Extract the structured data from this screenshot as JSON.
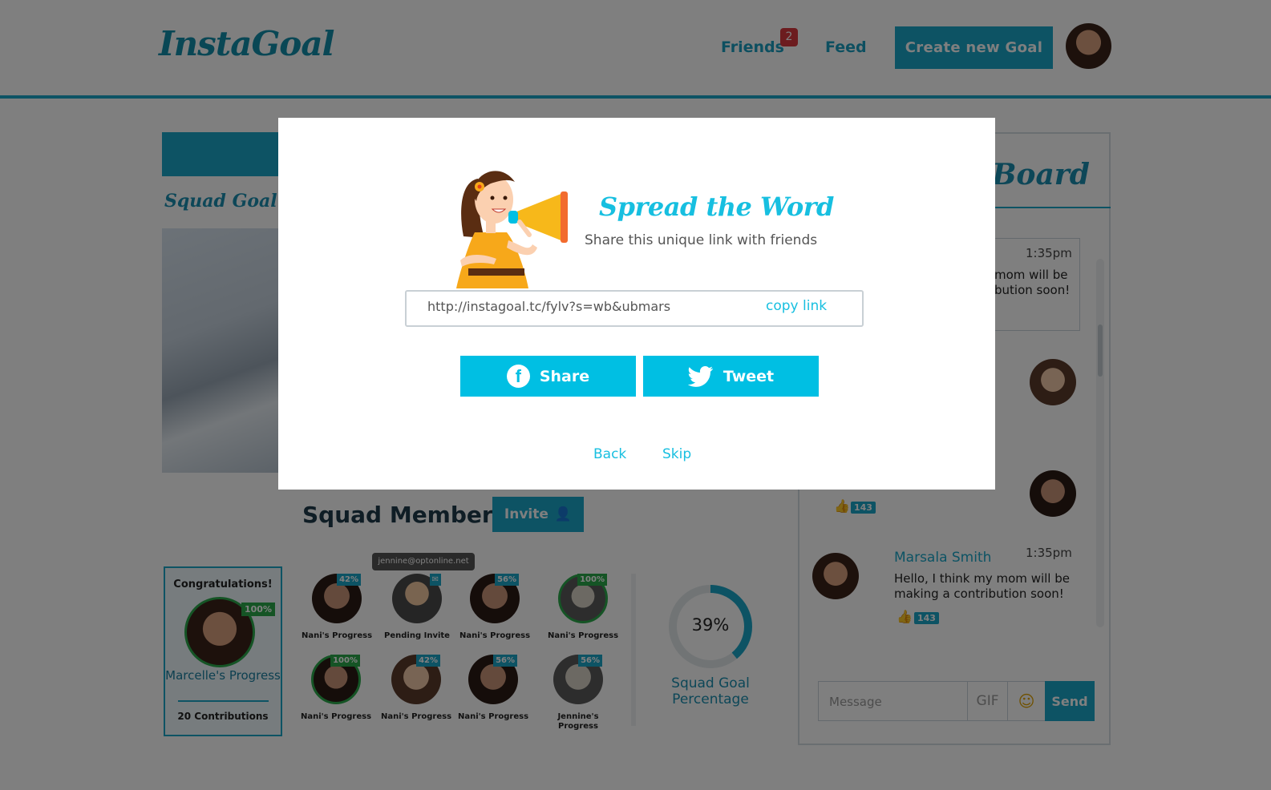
{
  "header": {
    "logo": "InstaGoal",
    "nav": {
      "friends": "Friends",
      "friends_badge": "2",
      "feed": "Feed"
    },
    "create_button": "Create new Goal"
  },
  "background": {
    "squad_goal_title": "Squad Goal",
    "board_title": "Board",
    "messages": [
      {
        "time": "1:35pm",
        "text": "mom will be\nbution soon!"
      },
      {
        "name": "Marsala Smith",
        "time": "1:35pm",
        "text": "Hello, I think my mom will be making a contribution soon!",
        "likes": "143"
      }
    ],
    "likes_mid": "143",
    "compose": {
      "placeholder": "Message",
      "gif": "GIF",
      "send": "Send"
    },
    "members_section": {
      "title": "Squad Members",
      "invite": "Invite",
      "tooltip": "jennine@optonline.net",
      "congrats": {
        "title": "Congratulations!",
        "percent": "100%",
        "name": "Marcelle's Progress",
        "contributions": "20 Contributions"
      },
      "members": [
        {
          "label": "Nani's Progress",
          "percent": "42%"
        },
        {
          "label": "Pending Invite",
          "percent": ""
        },
        {
          "label": "Nani's Progress",
          "percent": "56%"
        },
        {
          "label": "Nani's Progress",
          "percent": "100%"
        },
        {
          "label": "Nani's Progress",
          "percent": "100%"
        },
        {
          "label": "Nani's Progress",
          "percent": "42%"
        },
        {
          "label": "Nani's Progress",
          "percent": "56%"
        },
        {
          "label": "Jennine's Progress",
          "percent": "56%"
        }
      ]
    },
    "squad_percentage": {
      "value": "39%",
      "percent": 39,
      "title": "Squad Goal Percentage"
    }
  },
  "modal": {
    "title": "Spread the Word",
    "subtitle": "Share this unique link with friends",
    "link": "http://instagoal.tc/fylv?s=wb&ubmars",
    "copy_label": "copy link",
    "share_label": "Share",
    "tweet_label": "Tweet",
    "back_label": "Back",
    "skip_label": "Skip"
  },
  "colors": {
    "accent": "#00bfe3",
    "brand": "#1aa6c8",
    "success": "#2aa94a",
    "badge": "#d9383f"
  }
}
